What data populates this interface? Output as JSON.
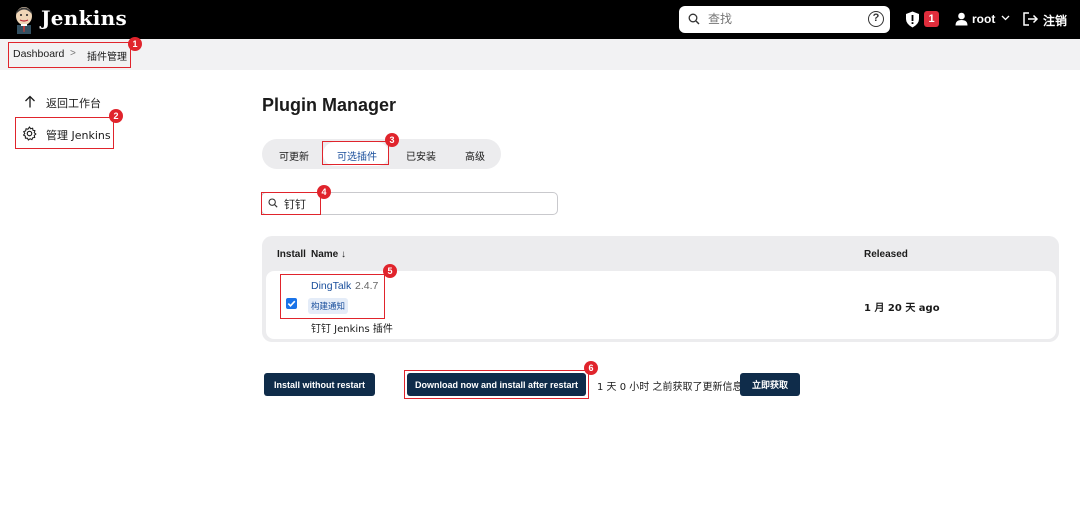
{
  "header": {
    "brand": "Jenkins",
    "search_placeholder": "查找",
    "help": "?",
    "security_count": "1",
    "user": "root",
    "logout": "注销"
  },
  "breadcrumb": {
    "home": "Dashboard",
    "separator": ">",
    "current": "插件管理"
  },
  "sidebar": {
    "items": [
      {
        "label": "返回工作台",
        "icon": "arrow-up-icon"
      },
      {
        "label": "管理 Jenkins",
        "icon": "gear-icon"
      }
    ]
  },
  "main": {
    "title": "Plugin Manager",
    "tabs": [
      {
        "label": "可更新"
      },
      {
        "label": "可选插件",
        "active": true
      },
      {
        "label": "已安装"
      },
      {
        "label": "高级"
      }
    ],
    "filter_value": "钉钉",
    "table": {
      "headers": {
        "install": "Install",
        "name": "Name ↓",
        "released": "Released"
      },
      "rows": [
        {
          "checked": true,
          "name": "DingTalk",
          "version": "2.4.7",
          "tag": "构建通知",
          "description": "钉钉 Jenkins 插件",
          "released": "1 月 20 天 ago"
        }
      ]
    },
    "actions": {
      "install_without_restart": "Install without restart",
      "download_install_after_restart": "Download now and install after restart",
      "update_info": "1 天 0 小时 之前获取了更新信息",
      "check_now": "立即获取"
    }
  },
  "annotations": [
    "1",
    "2",
    "3",
    "4",
    "5",
    "6"
  ],
  "colors": {
    "topbar": "#000000",
    "accent": "#1a4f9c",
    "button": "#0f2c4a",
    "annotation": "#e0242c",
    "badge": "#e02d3c"
  }
}
